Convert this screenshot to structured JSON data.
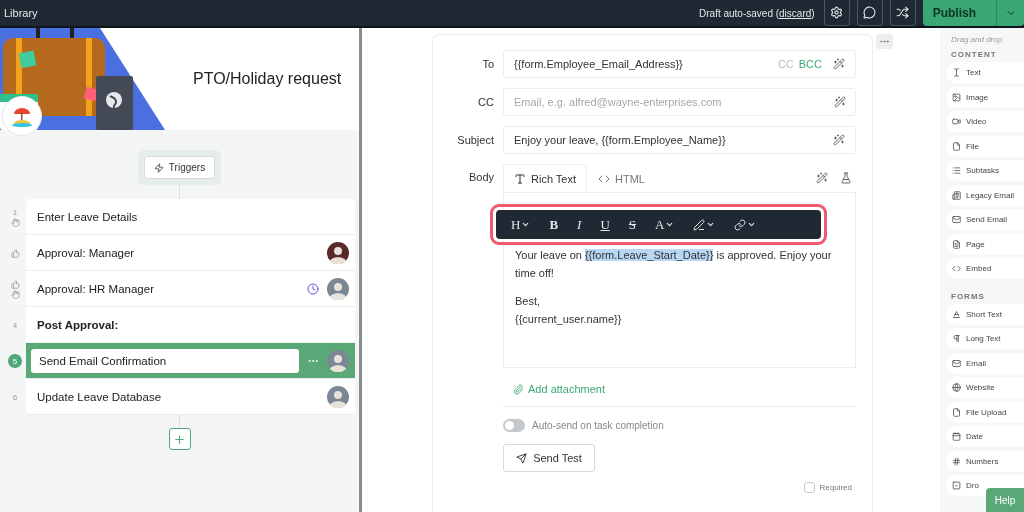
{
  "topbar": {
    "breadcrumb": "Library",
    "save_status": {
      "prefix": "Draft auto-saved (",
      "link": "discard",
      "suffix": ")"
    },
    "icon_buttons": [
      {
        "kind": "settings"
      },
      {
        "kind": "comment"
      },
      {
        "kind": "shuffle"
      }
    ],
    "publish": "Publish"
  },
  "workflow": {
    "title": "PTO/Holiday request",
    "trigger": "Triggers",
    "steps": [
      {
        "number": "1",
        "manual": true,
        "label": "Enter Leave Details",
        "kind": "task",
        "selected": false
      },
      {
        "approval": true,
        "label": "Approval: Manager",
        "kind": "task",
        "selected": false,
        "avatar": true
      },
      {
        "approval": true,
        "manual": true,
        "label": "Approval: HR Manager",
        "kind": "task",
        "selected": false,
        "avatar": true,
        "scheduled": true
      },
      {
        "number": "4",
        "label": "Post Approval:",
        "kind": "heading",
        "selected": false
      },
      {
        "number": "5",
        "label": "Send Email Confirmation",
        "kind": "task",
        "selected": true,
        "avatar": true
      },
      {
        "number": "6",
        "label": "Update Leave Database",
        "kind": "task",
        "selected": false,
        "avatar": true
      }
    ]
  },
  "email": {
    "to": {
      "label": "To",
      "value": "{{form.Employee_Email_Address}}",
      "cc": "CC",
      "bcc": "BCC"
    },
    "cc": {
      "label": "CC",
      "placeholder": "Email, e.g. alfred@wayne-enterprises.com"
    },
    "subject": {
      "label": "Subject",
      "value": "Enjoy your leave, {{form.Employee_Name}}"
    },
    "body_label": "Body",
    "tabs": [
      {
        "label": "Rich Text",
        "selected": true
      },
      {
        "label": "HTML",
        "selected": false
      }
    ],
    "toolbar": [
      {
        "kind": "heading",
        "label": "H"
      },
      {
        "kind": "bold",
        "label": "B"
      },
      {
        "kind": "italic",
        "label": "I"
      },
      {
        "kind": "underline",
        "label": "U"
      },
      {
        "kind": "strike",
        "label": "S"
      },
      {
        "kind": "color",
        "label": "A"
      },
      {
        "kind": "highlight"
      },
      {
        "kind": "link"
      }
    ],
    "body": [
      [
        {
          "text": "Your leave on ",
          "highlighted": false
        },
        {
          "text": "{{form.Leave_Start_Date}}",
          "highlighted": true
        },
        {
          "text": " is approved. Enjoy your time off!",
          "highlighted": false
        }
      ],
      [
        {
          "text": "Best,",
          "highlighted": false
        }
      ],
      [
        {
          "text": "{{current_user.name}}",
          "highlighted": false
        }
      ]
    ],
    "attachment": "Add attachment",
    "auto_send": {
      "label": "Auto-send on task completion",
      "on": false
    },
    "send_test": "Send Test",
    "required": {
      "label": "Required",
      "checked": false
    }
  },
  "palette": {
    "hint": "Drag and drop",
    "sections": [
      {
        "title": "CONTENT",
        "items": [
          "Text",
          "Image",
          "Video",
          "File",
          "Subtasks",
          "Legacy Email",
          "Send Email",
          "Page",
          "Embed"
        ]
      },
      {
        "title": "FORMS",
        "items": [
          "Short Text",
          "Long Text",
          "Email",
          "Website",
          "File Upload",
          "Date",
          "Numbers",
          "Dro"
        ]
      }
    ]
  },
  "help": "Help"
}
